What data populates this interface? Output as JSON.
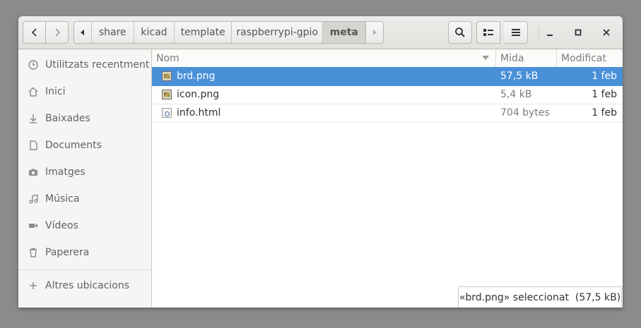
{
  "breadcrumb": {
    "items": [
      {
        "label": "share"
      },
      {
        "label": "kicad"
      },
      {
        "label": "template"
      },
      {
        "label": "raspberrypi-gpio"
      },
      {
        "label": "meta"
      }
    ]
  },
  "sidebar": {
    "items": [
      {
        "label": "Utilitzats recentment",
        "icon": "clock-icon"
      },
      {
        "label": "Inici",
        "icon": "home-icon"
      },
      {
        "label": "Baixades",
        "icon": "download-icon"
      },
      {
        "label": "Documents",
        "icon": "document-icon"
      },
      {
        "label": "Imatges",
        "icon": "camera-icon"
      },
      {
        "label": "Música",
        "icon": "music-icon"
      },
      {
        "label": "Vídeos",
        "icon": "video-icon"
      },
      {
        "label": "Paperera",
        "icon": "trash-icon"
      },
      {
        "label": "Altres ubicacions",
        "icon": "plus-icon"
      }
    ]
  },
  "columns": {
    "name": "Nom",
    "size": "Mida",
    "modified": "Modificat"
  },
  "files": [
    {
      "name": "brd.png",
      "size": "57,5 kB",
      "modified": "1 feb",
      "icon": "image-file-icon",
      "selected": true
    },
    {
      "name": "icon.png",
      "size": "5,4 kB",
      "modified": "1 feb",
      "icon": "image-file-icon",
      "selected": false
    },
    {
      "name": "info.html",
      "size": "704 bytes",
      "modified": "1 feb",
      "icon": "html-file-icon",
      "selected": false
    }
  ],
  "status": {
    "text": "«brd.png» seleccionat  (57,5 kB)"
  },
  "colors": {
    "selection": "#4a90d9",
    "desktop": "#8b8b8b"
  }
}
